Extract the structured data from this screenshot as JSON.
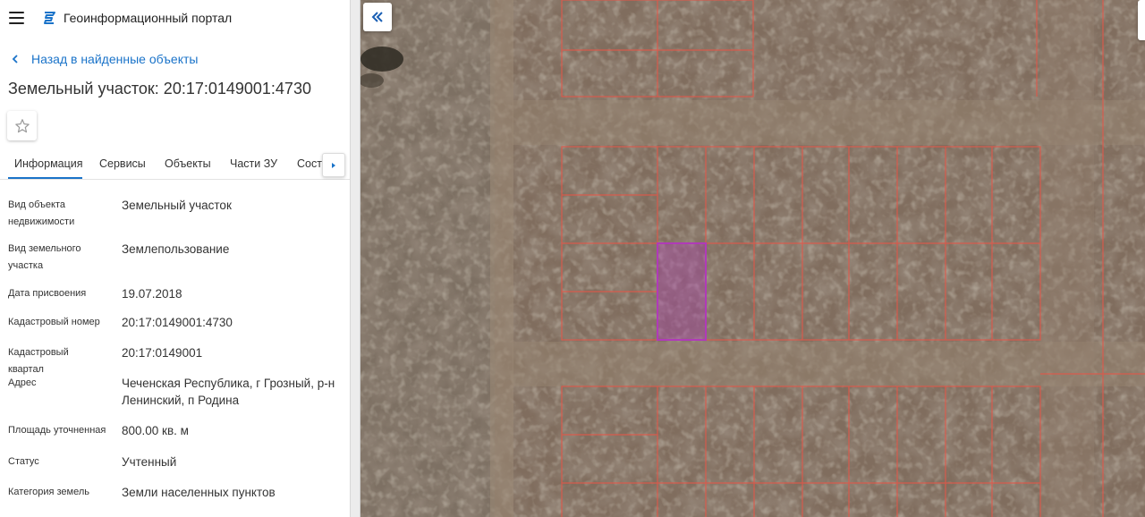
{
  "app": {
    "title": "Геоинформационный портал"
  },
  "icons": {
    "menu": "menu-icon",
    "logo": "portal-logo-icon",
    "back": "chevron-left-icon",
    "favorite": "star-icon",
    "tabs_scroll": "chevron-right-icon",
    "collapse": "double-chevron-left-icon"
  },
  "nav": {
    "back_label": "Назад в найденные объекты"
  },
  "object": {
    "title": "Земельный участок: 20:17:0149001:4730"
  },
  "tabs": [
    {
      "label": "Информация",
      "active": true
    },
    {
      "label": "Сервисы"
    },
    {
      "label": "Объекты"
    },
    {
      "label": "Части ЗУ"
    },
    {
      "label": "Состав"
    }
  ],
  "properties": [
    {
      "label": "Вид объекта недвижимости",
      "value": "Земельный участок"
    },
    {
      "label": "Вид земельного участка",
      "value": "Землепользование"
    },
    {
      "label": "Дата присвоения",
      "value": "19.07.2018"
    },
    {
      "label": "Кадастровый номер",
      "value": "20:17:0149001:4730"
    },
    {
      "label": "Кадастровый квартал",
      "value": "20:17:0149001"
    },
    {
      "label": "Адрес",
      "value": "Чеченская Республика, г Грозный, р-н Ленинский, п Родина"
    },
    {
      "label": "Площадь уточненная",
      "value": "800.00 кв. м"
    },
    {
      "label": "Статус",
      "value": "Учтенный"
    },
    {
      "label": "Категория земель",
      "value": "Земли населенных пунктов"
    }
  ],
  "colors": {
    "accent": "#1a73c9",
    "parcel_border": "#e0584a",
    "selected_parcel": "#b03ab8",
    "terrain": "#7c6a5c"
  }
}
